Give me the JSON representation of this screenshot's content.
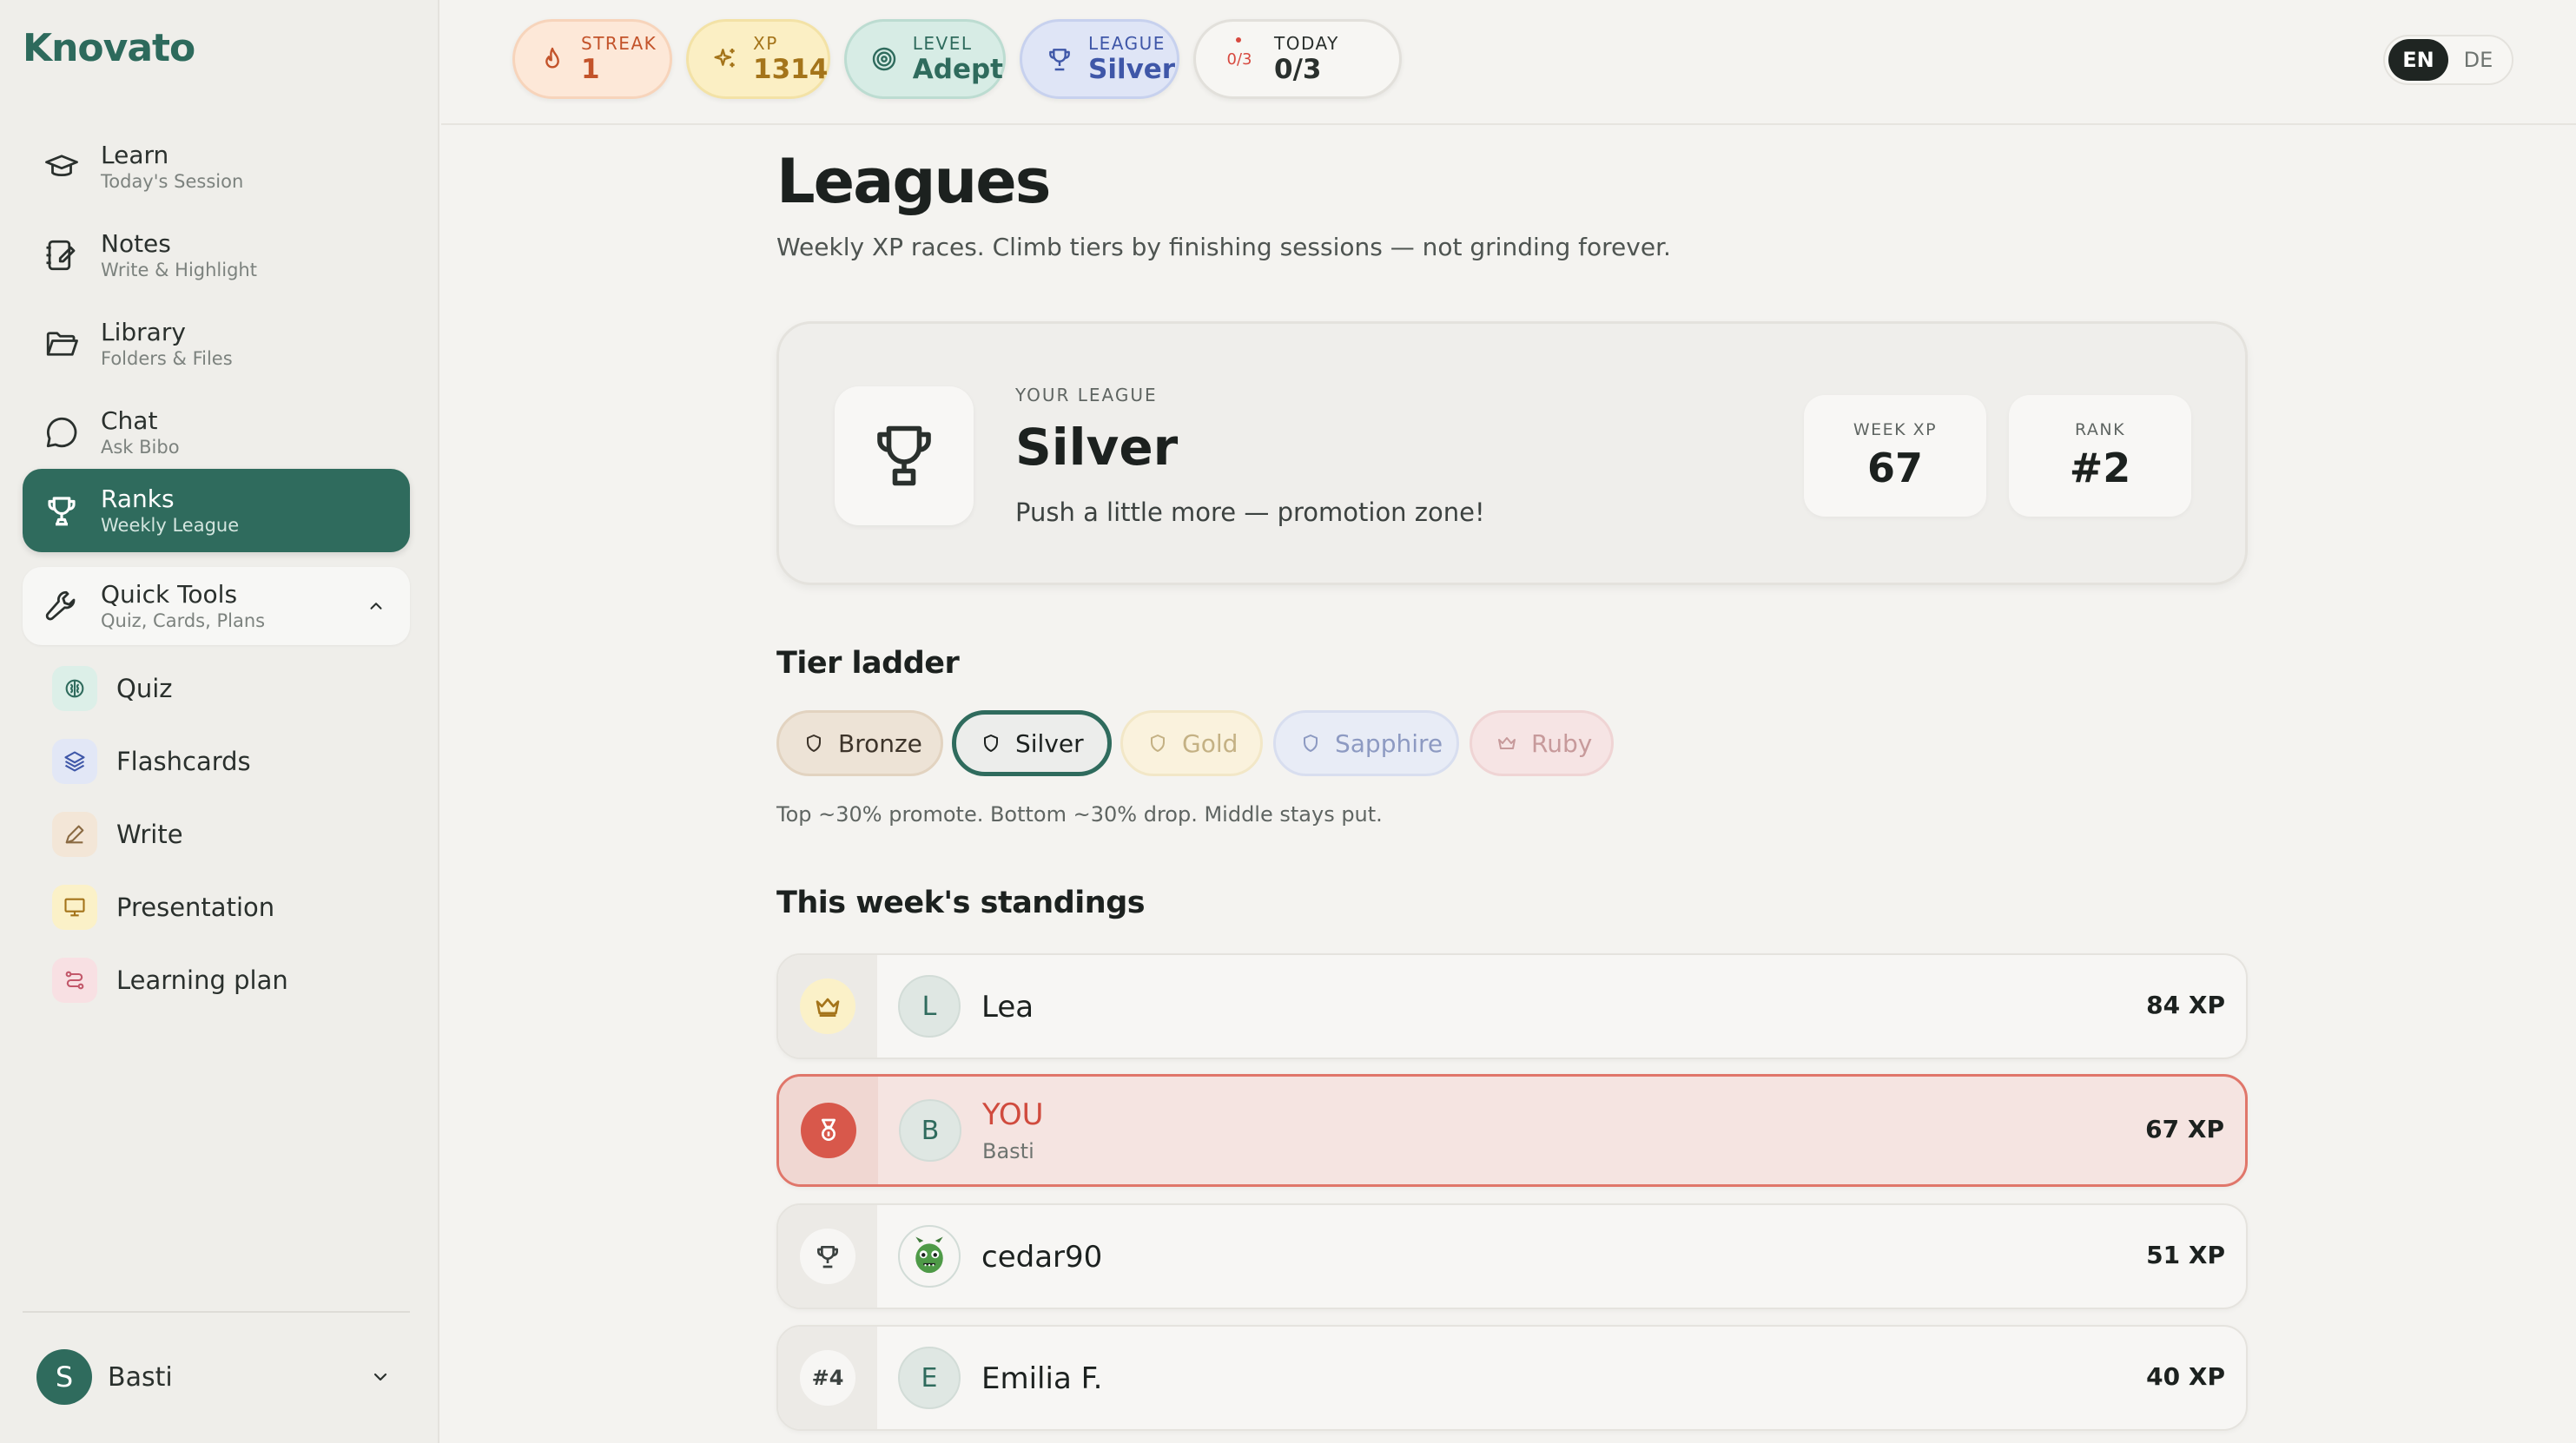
{
  "brand": "Knovato",
  "sidebar": {
    "items": [
      {
        "title": "Learn",
        "sub": "Today's Session"
      },
      {
        "title": "Notes",
        "sub": "Write & Highlight"
      },
      {
        "title": "Library",
        "sub": "Folders & Files"
      },
      {
        "title": "Chat",
        "sub": "Ask Bibo"
      },
      {
        "title": "Ranks",
        "sub": "Weekly League"
      }
    ],
    "tools": {
      "title": "Quick Tools",
      "sub": "Quiz, Cards, Plans"
    },
    "tool_items": [
      "Quiz",
      "Flashcards",
      "Write",
      "Presentation",
      "Learning plan"
    ],
    "user": {
      "initial": "S",
      "name": "Basti"
    }
  },
  "topbar": {
    "streak": {
      "label": "STREAK",
      "value": "1"
    },
    "xp": {
      "label": "XP",
      "value": "1314"
    },
    "level": {
      "label": "LEVEL",
      "value": "Adept"
    },
    "league": {
      "label": "LEAGUE",
      "value": "Silver"
    },
    "today": {
      "label": "TODAY",
      "value": "0/3",
      "ring": "0/3"
    },
    "lang": [
      "EN",
      "DE"
    ],
    "lang_active": "EN"
  },
  "main": {
    "title": "Leagues",
    "subtitle": "Weekly XP races. Climb tiers by finishing sessions — not grinding forever.",
    "card": {
      "eyebrow": "YOUR LEAGUE",
      "league": "Silver",
      "message": "Push a little more — promotion zone!",
      "week_xp_label": "WEEK XP",
      "week_xp": "67",
      "rank_label": "RANK",
      "rank": "#2"
    },
    "tier_heading": "Tier ladder",
    "tiers": [
      "Bronze",
      "Silver",
      "Gold",
      "Sapphire",
      "Ruby"
    ],
    "current_tier": "Silver",
    "tier_note": "Top ~30% promote. Bottom ~30% drop. Middle stays put.",
    "standings_heading": "This week's standings",
    "standings": [
      {
        "rank_icon": "crown-icon",
        "initial": "L",
        "name": "Lea",
        "sub": "",
        "xp": "84 XP"
      },
      {
        "rank_icon": "medal-icon",
        "initial": "B",
        "name": "YOU",
        "sub": "Basti",
        "xp": "67 XP"
      },
      {
        "rank_icon": "trophy-icon",
        "initial": "",
        "name": "cedar90",
        "sub": "",
        "xp": "51 XP"
      },
      {
        "rank_label": "#4",
        "initial": "E",
        "name": "Emilia F.",
        "sub": "",
        "xp": "40 XP"
      }
    ]
  },
  "colors": {
    "accent": "#2f6b5d",
    "you_highlight": "#e0766a",
    "you_text": "#d04b3e"
  }
}
